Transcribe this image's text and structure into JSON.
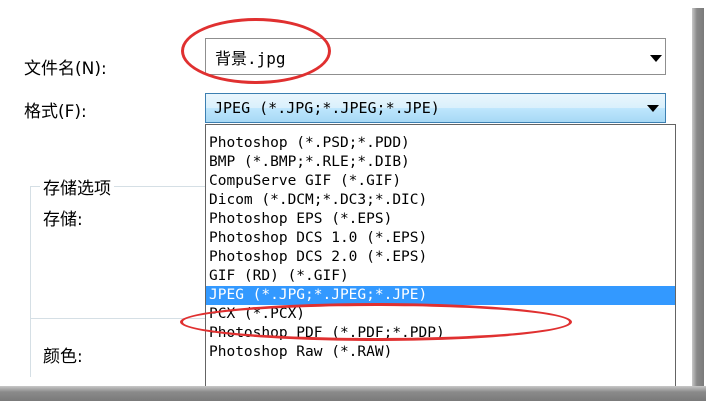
{
  "dialog": {
    "filename_label": "文件名(N):",
    "filename_value": "背景.jpg",
    "format_label": "格式(F):",
    "format_selected": "JPEG (*.JPG;*.JPEG;*.JPE)",
    "group_title": "存储选项",
    "storage_label": "存储:",
    "color_label": "颜色:"
  },
  "format_options": [
    "Photoshop (*.PSD;*.PDD)",
    "BMP (*.BMP;*.RLE;*.DIB)",
    "CompuServe GIF (*.GIF)",
    "Dicom (*.DCM;*.DC3;*.DIC)",
    "Photoshop EPS (*.EPS)",
    "Photoshop DCS 1.0 (*.EPS)",
    "Photoshop DCS 2.0 (*.EPS)",
    "GIF (RD) (*.GIF)",
    "JPEG (*.JPG;*.JPEG;*.JPE)",
    "PCX (*.PCX)",
    "Photoshop PDF (*.PDF;*.PDP)",
    "Photoshop Raw (*.RAW)"
  ],
  "selected_index": 8,
  "colors": {
    "highlight": "#3399ff",
    "annotation_ring": "#e03030"
  },
  "icons": {
    "dropdown": "chevron-down-icon"
  }
}
